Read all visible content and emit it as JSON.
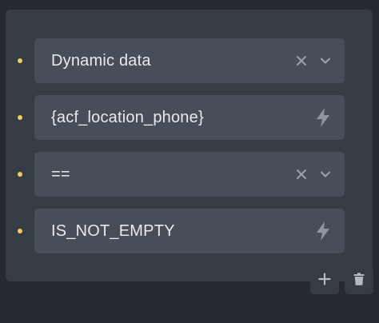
{
  "conditions": [
    {
      "value": "Dynamic data",
      "kind": "select",
      "clear_icon": "close-icon",
      "dropdown_icon": "chevron-down-icon"
    },
    {
      "value": "{acf_location_phone}",
      "kind": "dynamic-input",
      "action_icon": "bolt-icon"
    },
    {
      "value": "==",
      "kind": "select",
      "clear_icon": "close-icon",
      "dropdown_icon": "chevron-down-icon"
    },
    {
      "value": "IS_NOT_EMPTY",
      "kind": "dynamic-input",
      "action_icon": "bolt-icon"
    }
  ],
  "actions": {
    "add_icon": "plus-icon",
    "delete_icon": "trash-icon"
  },
  "colors": {
    "background": "#262a30",
    "panel": "#363c44",
    "field": "#474e58",
    "text": "#e8eaee",
    "icon": "#9aa2ad",
    "bullet": "#f2cd5c"
  }
}
